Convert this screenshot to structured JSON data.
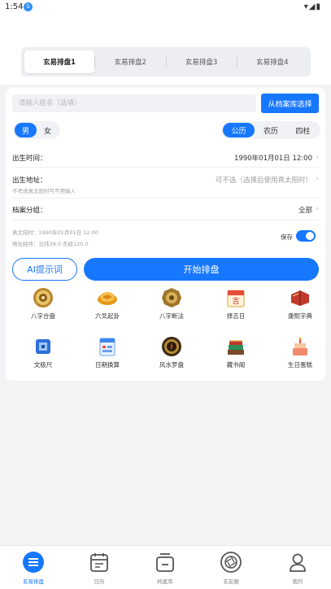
{
  "status_bar": {
    "time": "1:54",
    "badge": "S"
  },
  "tabs": [
    {
      "label": "玄易排盘1",
      "active": true
    },
    {
      "label": "玄易排盘2",
      "active": false
    },
    {
      "label": "玄易排盘3",
      "active": false
    },
    {
      "label": "玄易排盘4",
      "active": false
    }
  ],
  "form": {
    "name_placeholder": "请输入姓名（选填）",
    "archive_button": "从档案库选择",
    "gender": {
      "male": "男",
      "female": "女",
      "selected": "男"
    },
    "calendar": {
      "solar": "公历",
      "lunar": "农历",
      "pillars": "四柱",
      "selected": "公历"
    },
    "birth_time": {
      "label": "出生时间：",
      "value": "1990年01月01日 12:00"
    },
    "birth_place": {
      "label": "出生地址：",
      "value": "可不选（选择后使用真太阳时）",
      "note": "不考虑真太阳时可不用输入"
    },
    "archive_group": {
      "label": "档案分组：",
      "value": "全部"
    },
    "true_solar": "真太阳时：1990年01月01日 12:00",
    "location": "地址经纬：北纬39.0 东经120.0",
    "save_label": "保存",
    "save_enabled": true,
    "ai_button": "AI提示词",
    "start_button": "开始排盘"
  },
  "tools": [
    {
      "label": "八字合盘",
      "icon": "compass-plate-icon"
    },
    {
      "label": "六爻起卦",
      "icon": "turtle-shell-icon"
    },
    {
      "label": "八字断法",
      "icon": "bagua-disc-icon"
    },
    {
      "label": "择吉日",
      "icon": "calendar-icon"
    },
    {
      "label": "康熙字典",
      "icon": "book-icon"
    },
    {
      "label": "文极尺",
      "icon": "ruler-icon"
    },
    {
      "label": "日期换算",
      "icon": "date-calc-icon"
    },
    {
      "label": "风水罗盘",
      "icon": "luopan-icon"
    },
    {
      "label": "藏书阁",
      "icon": "books-stack-icon"
    },
    {
      "label": "生日蛋糕",
      "icon": "cake-icon"
    }
  ],
  "bottom_nav": [
    {
      "label": "玄易排盘",
      "icon": "menu-icon",
      "active": true
    },
    {
      "label": "日历",
      "icon": "calendar-icon",
      "active": false
    },
    {
      "label": "档案库",
      "icon": "archive-icon",
      "active": false
    },
    {
      "label": "玄友圈",
      "icon": "aperture-icon",
      "active": false
    },
    {
      "label": "我的",
      "icon": "user-icon",
      "active": false
    }
  ],
  "colors": {
    "accent": "#1677ff",
    "background": "#f3f3f5"
  }
}
